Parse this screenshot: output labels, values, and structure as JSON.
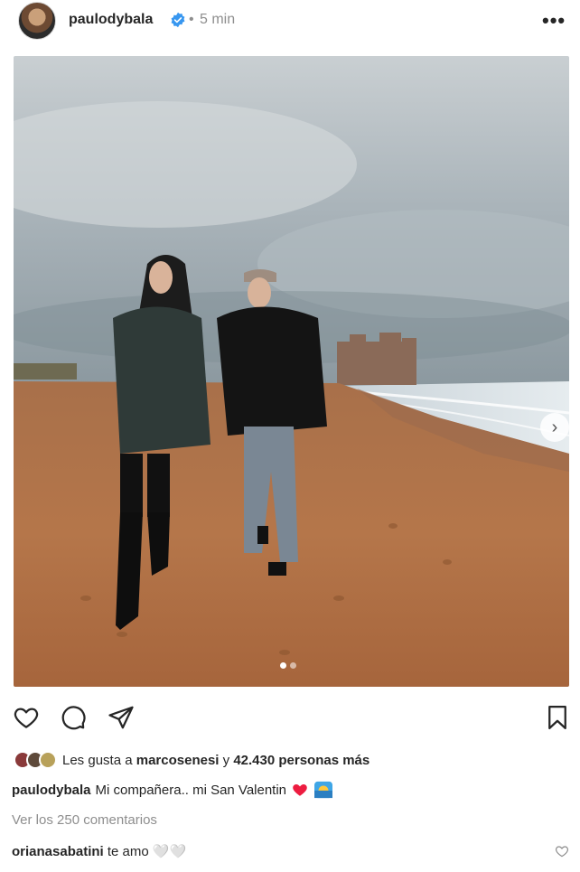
{
  "header": {
    "username": "paulodybala",
    "separator": "•",
    "time": "5 min",
    "more_label": "•••"
  },
  "post": {
    "carousel_next": "›",
    "carousel_index": 1,
    "carousel_count": 2
  },
  "likes": {
    "prefix": "Les gusta a",
    "user": "marcosenesi",
    "middle": "y",
    "count": "42.430 personas más"
  },
  "caption": {
    "username": "paulodybala",
    "text": "Mi compañera.. mi San Valentin"
  },
  "comments_link": "Ver los 250 comentarios",
  "comment": {
    "username": "orianasabatini",
    "text": "te amo 🤍🤍"
  },
  "colors": {
    "verified": "#3897f0",
    "heart": "#ed1c40",
    "secondary_text": "#8e8e8e"
  }
}
